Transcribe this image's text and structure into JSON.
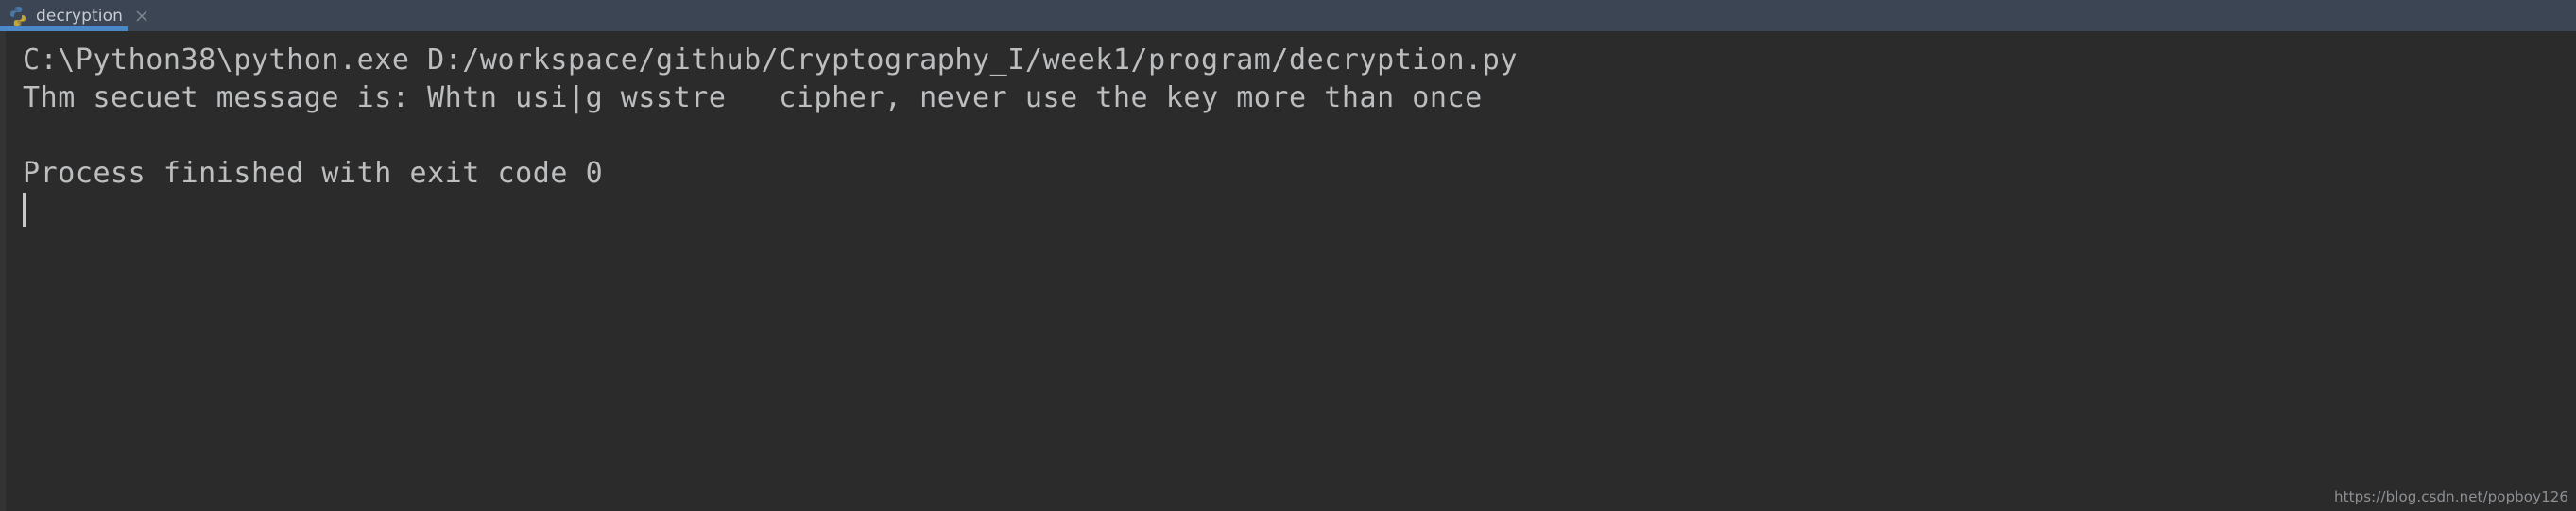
{
  "window": {
    "background_color": "#2b2b2b",
    "tabbar_background_color": "#3c4553"
  },
  "tabbar": {
    "active_tab_indicator_color": "#4a88c7",
    "tabs": [
      {
        "label": "decryption",
        "icon": "python-file-icon",
        "close_icon": "close-icon",
        "active": true
      }
    ]
  },
  "console": {
    "text_color": "#bcbec0",
    "caret": "text-caret",
    "lines": [
      "C:\\Python38\\python.exe D:/workspace/github/Cryptography_I/week1/program/decryption.py",
      "Thm secuet message is: Whtn usi|g wsstre   cipher, never use the key more than once",
      "",
      "Process finished with exit code 0"
    ]
  },
  "watermark": {
    "text": "https://blog.csdn.net/popboy126",
    "color": "#8d9094"
  }
}
